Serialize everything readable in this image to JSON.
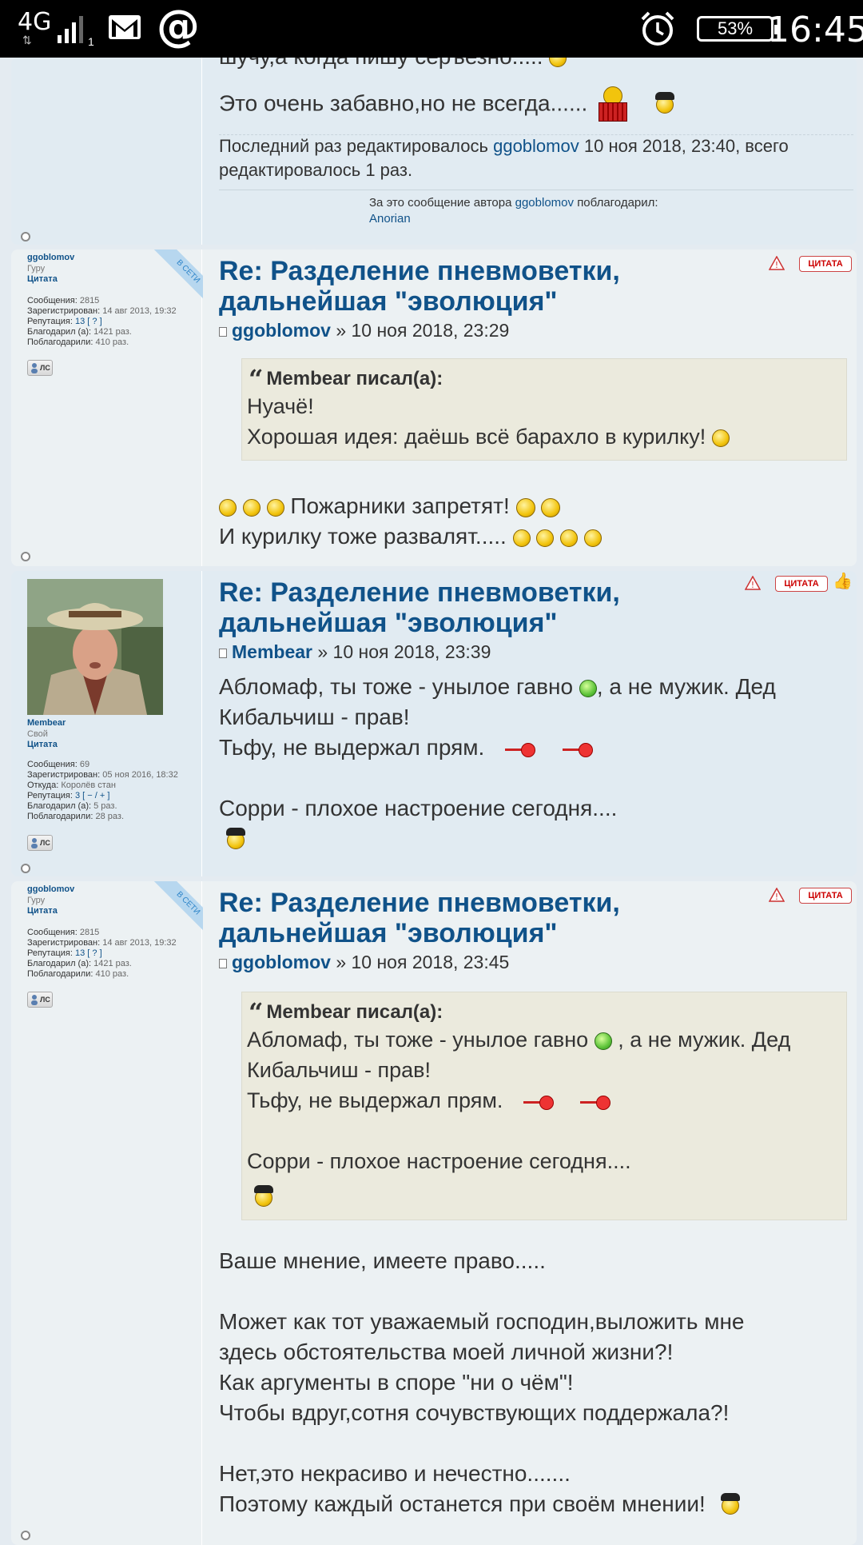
{
  "status_bar": {
    "network": "4G",
    "sim_slot": "1",
    "battery": "53%",
    "time": "16:45",
    "icons": [
      "signal-icon",
      "gmail-icon",
      "at-icon",
      "alarm-icon",
      "battery-icon"
    ]
  },
  "post0": {
    "line_top": "шучу,а когда пишу серъезно.....",
    "line_fun": "Это очень забавно,но не всегда......",
    "edit_prefix": "Последний раз редактировалось",
    "edit_user": "ggoblomov",
    "edit_suffix": "10 ноя 2018, 23:40, всего редактировалось 1 раз.",
    "thanks_prefix": "За это сообщение автора",
    "thanks_user": "ggoblomov",
    "thanks_suffix": "поблагодарил:",
    "thanks_by": "Anorian"
  },
  "post1": {
    "profile": {
      "name": "ggoblomov",
      "rank": "Гуру",
      "cite": "Цитата",
      "online": "В СЕТИ",
      "messages_label": "Сообщения:",
      "messages": "2815",
      "registered_label": "Зарегистрирован:",
      "registered": "14 авг 2013, 19:32",
      "reputation_label": "Репутация:",
      "reputation": "13",
      "reputation_extra": "[ ? ]",
      "thanked_label": "Благодарил (а):",
      "thanked": "1421 раз.",
      "was_thanked_label": "Поблагодарили:",
      "was_thanked": "410 раз.",
      "pm": "ЛС"
    },
    "title_line1": "Re: Разделение пневмоветки,",
    "title_line2": "дальнейшая \"эволюция\"",
    "author": "ggoblomov",
    "date": "» 10 ноя 2018, 23:29",
    "cite_button": "ЦИТАТА",
    "quote": {
      "header": "Membear писал(а):",
      "line1": "Нуачё!",
      "line2": "Хорошая идея: даёшь всё барахло в курилку!"
    },
    "body_line1": "Пожарники запретят!",
    "body_line2": "И курилку тоже развалят....."
  },
  "post2": {
    "profile": {
      "name": "Membear",
      "rank": "Свой",
      "cite": "Цитата",
      "messages_label": "Сообщения:",
      "messages": "69",
      "registered_label": "Зарегистрирован:",
      "registered": "05 ноя 2016, 18:32",
      "from_label": "Откуда:",
      "from": "Королёв стан",
      "reputation_label": "Репутация:",
      "reputation": "3",
      "reputation_extra": "[ − / + ]",
      "thanked_label": "Благодарил (а):",
      "thanked": "5 раз.",
      "was_thanked_label": "Поблагодарили:",
      "was_thanked": "28 раз.",
      "pm": "ЛС"
    },
    "title_line1": "Re: Разделение пневмоветки,",
    "title_line2": "дальнейшая \"эволюция\"",
    "author": "Membear",
    "date": "» 10 ноя 2018, 23:39",
    "cite_button": "ЦИТАТА",
    "line1a": "Абломаф, ты тоже - унылое гавно",
    "line1b": ", а не мужик. Дед",
    "line2": "Кибальчиш - прав!",
    "line3": "Тьфу, не выдержал прям.",
    "line4": "Сорри - плохое настроение сегодня...."
  },
  "post3": {
    "profile": {
      "name": "ggoblomov",
      "rank": "Гуру",
      "cite": "Цитата",
      "online": "В СЕТИ",
      "messages_label": "Сообщения:",
      "messages": "2815",
      "registered_label": "Зарегистрирован:",
      "registered": "14 авг 2013, 19:32",
      "reputation_label": "Репутация:",
      "reputation": "13",
      "reputation_extra": "[ ? ]",
      "thanked_label": "Благодарил (а):",
      "thanked": "1421 раз.",
      "was_thanked_label": "Поблагодарили:",
      "was_thanked": "410 раз.",
      "pm": "ЛС"
    },
    "title_line1": "Re: Разделение пневмоветки,",
    "title_line2": "дальнейшая \"эволюция\"",
    "author": "ggoblomov",
    "date": "» 10 ноя 2018, 23:45",
    "cite_button": "ЦИТАТА",
    "quote": {
      "header": "Membear писал(а):",
      "line1a": "Абломаф, ты тоже - унылое гавно",
      "line1b": ", а не мужик. Дед",
      "line2": "Кибальчиш - прав!",
      "line3": "Тьфу, не выдержал прям.",
      "line4": "Сорри - плохое настроение сегодня...."
    },
    "body": [
      "Ваше мнение, имеете право.....",
      "Может как тот уважаемый господин,выложить мне",
      "здесь обстоятельства моей личной жизни?!",
      "Как аргументы в споре \"ни о чём\"!",
      "Чтобы вдруг,сотня сочувствующих поддержала?!",
      "Нет,это некрасиво и нечестно.......",
      "Поэтому каждый останется при своём мнении!"
    ]
  }
}
